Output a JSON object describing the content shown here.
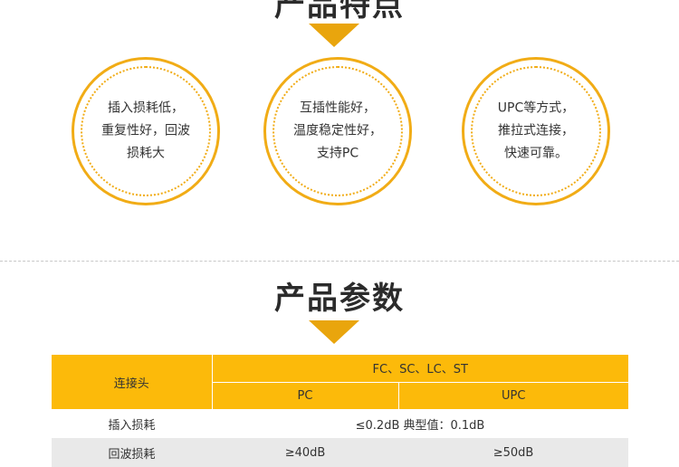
{
  "features_section": {
    "title": "产品特点",
    "items": [
      {
        "line1": "插入损耗低，",
        "line2": "重复性好，回波",
        "line3": "损耗大"
      },
      {
        "line1": "互插性能好，",
        "line2": "温度稳定性好，",
        "line3": "支持PC"
      },
      {
        "line1": "UPC等方式，",
        "line2": "推拉式连接，",
        "line3": "快速可靠。"
      }
    ]
  },
  "params_section": {
    "title": "产品参数",
    "table": {
      "connector_label": "连接头",
      "connector_types": "FC、SC、LC、ST",
      "pc_label": "PC",
      "upc_label": "UPC",
      "rows": [
        {
          "label": "插入损耗",
          "value": "≤0.2dB 典型值：0.1dB"
        },
        {
          "label": "回波损耗",
          "pc": "≥40dB",
          "upc": "≥50dB"
        }
      ]
    }
  },
  "colors": {
    "accent": "#f1ac16",
    "header_fill": "#fcba0a",
    "arrow": "#e9a50d"
  }
}
